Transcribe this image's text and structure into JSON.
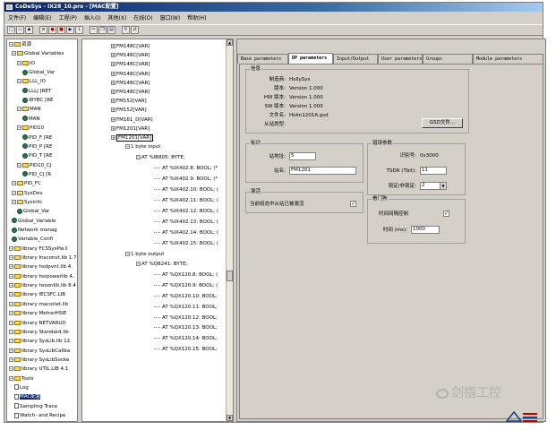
{
  "window": {
    "title": "CoDeSys - IX28_10.pro - [MAC配置]"
  },
  "menu": [
    "文件(F)",
    "编辑(E)",
    "工程(P)",
    "插入(I)",
    "其他(X)",
    "在线(O)",
    "窗口(W)",
    "帮助(H)"
  ],
  "toolbar": {
    "icons": [
      "new-icon",
      "open-icon",
      "save-icon",
      "build-icon",
      "login-icon",
      "stop-icon",
      "run-icon",
      "step-icon",
      "cut-icon",
      "copy-icon",
      "paste-icon",
      "find-icon",
      "replace-icon"
    ]
  },
  "left_tree": {
    "items": [
      {
        "label": "资源",
        "icon": "folder-icon"
      },
      {
        "label": "Global Variables",
        "icon": "folder-icon"
      },
      {
        "label": "IO",
        "icon": "folder-icon"
      },
      {
        "label": "Global_Var",
        "icon": "globe-icon"
      },
      {
        "label": "LLL_IO",
        "icon": "folder-icon"
      },
      {
        "label": "LLLJ [RET",
        "icon": "globe-icon"
      },
      {
        "label": "WYBC [RE",
        "icon": "globe-icon"
      },
      {
        "label": "MAN",
        "icon": "folder-icon"
      },
      {
        "label": "MAN",
        "icon": "globe-icon"
      },
      {
        "label": "PID10",
        "icon": "folder-icon"
      },
      {
        "label": "PID_F [RE",
        "icon": "globe-icon"
      },
      {
        "label": "PID_P [RE",
        "icon": "globe-icon"
      },
      {
        "label": "PID_T [RE",
        "icon": "globe-icon"
      },
      {
        "label": "PID10_CJ",
        "icon": "folder-icon"
      },
      {
        "label": "PID_CJ [R",
        "icon": "globe-icon"
      },
      {
        "label": "PID_FC",
        "icon": "folder-icon"
      },
      {
        "label": "SysDev",
        "icon": "folder-icon"
      },
      {
        "label": "Sysinfo",
        "icon": "folder-icon"
      },
      {
        "label": "Global_Var",
        "icon": "globe-icon"
      },
      {
        "label": "Global_Variable",
        "icon": "globe-icon"
      },
      {
        "label": "Network manag",
        "icon": "globe-icon"
      },
      {
        "label": "Variable_Confi",
        "icon": "globe-icon"
      },
      {
        "label": "library FCSSysPw.li",
        "icon": "folder-icon"
      },
      {
        "label": "library Insconvt.lib 1.7",
        "icon": "folder-icon"
      },
      {
        "label": "library hsdpvnt.lib 4.",
        "icon": "folder-icon"
      },
      {
        "label": "library hsrpowerlib 4.",
        "icon": "folder-icon"
      },
      {
        "label": "library hssonlib.lib 8.4",
        "icon": "folder-icon"
      },
      {
        "label": "library IECSFC.LIB",
        "icon": "folder-icon"
      },
      {
        "label": "library macoriet.lib",
        "icon": "folder-icon"
      },
      {
        "label": "library MetrarHSIE",
        "icon": "folder-icon"
      },
      {
        "label": "library NETVARUD",
        "icon": "folder-icon"
      },
      {
        "label": "library Standard.lib",
        "icon": "folder-icon"
      },
      {
        "label": "library SysLib.lib 12.",
        "icon": "folder-icon"
      },
      {
        "label": "library SysLibCallba",
        "icon": "folder-icon"
      },
      {
        "label": "library SysLibSocke",
        "icon": "folder-icon"
      },
      {
        "label": "library UTIL.LIB 4.1",
        "icon": "folder-icon"
      },
      {
        "label": "Tools",
        "icon": "folder-icon"
      },
      {
        "label": "Log",
        "icon": "doc-icon"
      },
      {
        "label": "MAC配置",
        "icon": "doc-icon"
      },
      {
        "label": "Sampling Trace",
        "icon": "doc-icon"
      },
      {
        "label": "Watch- and Recipe",
        "icon": "doc-icon"
      }
    ]
  },
  "mid_tree": {
    "items": [
      "FM148C[VAR]",
      "FM148C[VAR]",
      "FM148C[VAR]",
      "FM148C[VAR]",
      "FM148C[VAR]",
      "FM148C[VAR]",
      "FM152[VAR]",
      "FM152[VAR]",
      "FM161_D[VAR]",
      "FM1201[VAR]",
      "FM1201[VAR]",
      "1 byte input",
      "AT %IB805: BYTE;",
      "AT %IX402.8: BOOL; (*",
      "AT %IX402.9: BOOL; (*",
      "AT %IX402.10: BOOL; (",
      "AT %IX402.11: BOOL; (",
      "AT %IX402.12: BOOL; (",
      "AT %IX402.13: BOOL; (",
      "AT %IX402.14: BOOL; (",
      "AT %IX402.15: BOOL; (",
      "1 byte output",
      "AT %QB241: BYTE;",
      "AT %QX120.8: BOOL; (",
      "AT %QX120.9: BOOL; (",
      "AT %QX120.10: BOOL;",
      "AT %QX120.11: BOOL;",
      "AT %QX120.12: BOOL;",
      "AT %QX120.13: BOOL;",
      "AT %QX120.14: BOOL;",
      "AT %QX120.15: BOOL;"
    ]
  },
  "tabs": [
    "Base parameters",
    "DP parameters",
    "Input/Output",
    "User parameters",
    "Groups",
    "Module parameters"
  ],
  "active_tab": "DP parameters",
  "info": {
    "title": "信息",
    "rows": [
      {
        "k": "制造商:",
        "v": "HollySys"
      },
      {
        "k": "版本:",
        "v": "Version 1.000"
      },
      {
        "k": "HW 版本:",
        "v": "Version 1.000"
      },
      {
        "k": "SW 版本:",
        "v": "Version 1.000"
      },
      {
        "k": "文件名:",
        "v": "Holm1201A.gsd"
      },
      {
        "k": "从站类型:",
        "v": ""
      }
    ],
    "gsd_button": "GSD文件..."
  },
  "ident": {
    "title": "标识",
    "station_label": "站地址:",
    "station_value": "5",
    "name_label": "站名:",
    "name_value": "FM1201"
  },
  "activation": {
    "title": "激活",
    "label": "当前组态中从站已被激活",
    "checked": "✓"
  },
  "watchdog_params": {
    "title": "错误参数",
    "ident_label": "识别号:",
    "ident_value": "0x3000",
    "tsdr_label": "TSDR (Tbit):",
    "tsdr_value": "11",
    "lock_label": "锁定/非锁定:",
    "lock_value": "2"
  },
  "watchdog": {
    "title": "看门狗",
    "ctrl_label": "时间间隔控制",
    "ctrl_checked": "✓",
    "time_label": "时间 (ms):",
    "time_value": "1000"
  },
  "watermark": {
    "text": "剑指工控"
  }
}
